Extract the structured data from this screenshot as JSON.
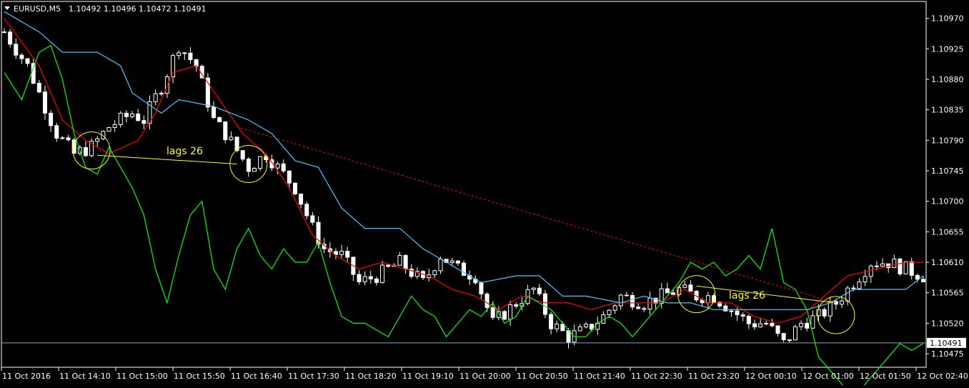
{
  "header": {
    "symbol": "EURUSD,M5",
    "quote": "1.10492 1.10496 1.10472 1.10491"
  },
  "annotations": [
    "lags 26",
    "lags 26"
  ],
  "colors": {
    "background": "#000000",
    "axis": "#ffffff",
    "candle": "#ffffff",
    "red_line": "#ff0000",
    "cyan_line": "#40c8ff",
    "green_line": "#00ff00",
    "yellow": "#ffff00",
    "price_line": "#8aa6b6"
  },
  "chart_data": {
    "type": "line",
    "title": "",
    "symbol": "EURUSD",
    "timeframe": "M5",
    "y_ticks": [
      "1.10970",
      "1.10925",
      "1.10880",
      "1.10835",
      "1.10790",
      "1.10745",
      "1.10700",
      "1.10655",
      "1.10610",
      "1.10565",
      "1.10520",
      "1.10475"
    ],
    "y_range": [
      1.10455,
      1.10995
    ],
    "x_tick_labels": [
      "11 Oct 2016",
      "11 Oct 14:10",
      "11 Oct 15:00",
      "11 Oct 15:50",
      "11 Oct 16:40",
      "11 Oct 17:30",
      "11 Oct 18:20",
      "11 Oct 19:10",
      "11 Oct 20:00",
      "11 Oct 20:50",
      "11 Oct 21:40",
      "11 Oct 22:30",
      "11 Oct 23:20",
      "12 Oct 00:10",
      "12 Oct 01:00",
      "12 Oct 01:50",
      "12 Oct 02:40"
    ],
    "current_price": "1.10491",
    "grid": false,
    "series": [
      {
        "style": "candles",
        "color": "#ffffff",
        "close_anchors": [
          [
            0,
            1.1095
          ],
          [
            4,
            1.109
          ],
          [
            7,
            1.1084
          ],
          [
            9,
            1.108
          ],
          [
            12,
            1.1077
          ],
          [
            15,
            1.1078
          ],
          [
            18,
            1.1081
          ],
          [
            22,
            1.1083
          ],
          [
            24,
            1.1082
          ],
          [
            27,
            1.1087
          ],
          [
            30,
            1.1093
          ],
          [
            33,
            1.109
          ],
          [
            36,
            1.1082
          ],
          [
            38,
            1.108
          ],
          [
            42,
            1.1075
          ],
          [
            45,
            1.1077
          ],
          [
            48,
            1.1074
          ],
          [
            50,
            1.1072
          ],
          [
            53,
            1.1066
          ],
          [
            55,
            1.1063
          ],
          [
            58,
            1.1062
          ],
          [
            61,
            1.1058
          ],
          [
            64,
            1.1059
          ],
          [
            68,
            1.1061
          ],
          [
            72,
            1.1058
          ],
          [
            75,
            1.1062
          ],
          [
            78,
            1.106
          ],
          [
            81,
            1.1059
          ],
          [
            84,
            1.1052
          ],
          [
            88,
            1.1055
          ],
          [
            91,
            1.1057
          ],
          [
            94,
            1.1052
          ],
          [
            97,
            1.105
          ],
          [
            100,
            1.1051
          ],
          [
            103,
            1.1053
          ],
          [
            106,
            1.1056
          ],
          [
            110,
            1.1055
          ],
          [
            113,
            1.1056
          ],
          [
            116,
            1.1057
          ],
          [
            119,
            1.1056
          ],
          [
            122,
            1.1056
          ],
          [
            125,
            1.1054
          ],
          [
            128,
            1.1052
          ],
          [
            131,
            1.1052
          ],
          [
            134,
            1.1049
          ],
          [
            137,
            1.1052
          ],
          [
            140,
            1.1053
          ],
          [
            143,
            1.1055
          ],
          [
            146,
            1.1058
          ],
          [
            149,
            1.1061
          ],
          [
            152,
            1.1061
          ],
          [
            155,
            1.106
          ],
          [
            158,
            1.1059
          ]
        ]
      },
      {
        "style": "line",
        "color": "#ff0000",
        "points": [
          [
            0,
            1.1097
          ],
          [
            6,
            1.109
          ],
          [
            10,
            1.1082
          ],
          [
            14,
            1.1079
          ],
          [
            18,
            1.1077
          ],
          [
            23,
            1.1079
          ],
          [
            26,
            1.1083
          ],
          [
            29,
            1.1089
          ],
          [
            33,
            1.109
          ],
          [
            37,
            1.1085
          ],
          [
            41,
            1.108
          ],
          [
            45,
            1.1077
          ],
          [
            49,
            1.1072
          ],
          [
            53,
            1.1065
          ],
          [
            57,
            1.1062
          ],
          [
            61,
            1.106
          ],
          [
            65,
            1.1061
          ],
          [
            69,
            1.106
          ],
          [
            73,
            1.1059
          ],
          [
            77,
            1.1057
          ],
          [
            81,
            1.1056
          ],
          [
            85,
            1.1054
          ],
          [
            89,
            1.1056
          ],
          [
            93,
            1.1055
          ],
          [
            97,
            1.1055
          ],
          [
            101,
            1.1054
          ],
          [
            105,
            1.1055
          ],
          [
            109,
            1.1055
          ],
          [
            113,
            1.1055
          ],
          [
            117,
            1.1057
          ],
          [
            121,
            1.1055
          ],
          [
            125,
            1.1055
          ],
          [
            129,
            1.1053
          ],
          [
            133,
            1.1052
          ],
          [
            137,
            1.1053
          ],
          [
            141,
            1.1056
          ],
          [
            145,
            1.1059
          ],
          [
            150,
            1.106
          ],
          [
            155,
            1.1061
          ],
          [
            158,
            1.1061
          ]
        ]
      },
      {
        "style": "line",
        "color": "#40c8ff",
        "points": [
          [
            0,
            1.1098
          ],
          [
            6,
            1.1095
          ],
          [
            10,
            1.1092
          ],
          [
            16,
            1.1092
          ],
          [
            20,
            1.109
          ],
          [
            22,
            1.1086
          ],
          [
            27,
            1.1083
          ],
          [
            30,
            1.1085
          ],
          [
            36,
            1.1084
          ],
          [
            42,
            1.1082
          ],
          [
            46,
            1.108
          ],
          [
            50,
            1.1076
          ],
          [
            54,
            1.1075
          ],
          [
            58,
            1.1069
          ],
          [
            62,
            1.1066
          ],
          [
            68,
            1.1066
          ],
          [
            72,
            1.1063
          ],
          [
            76,
            1.1061
          ],
          [
            82,
            1.1058
          ],
          [
            88,
            1.1059
          ],
          [
            92,
            1.1059
          ],
          [
            96,
            1.1056
          ],
          [
            100,
            1.1056
          ],
          [
            106,
            1.1055
          ],
          [
            110,
            1.1056
          ],
          [
            114,
            1.1055
          ],
          [
            118,
            1.1055
          ],
          [
            122,
            1.1054
          ],
          [
            126,
            1.1054
          ],
          [
            130,
            1.1054
          ],
          [
            134,
            1.1054
          ],
          [
            138,
            1.1054
          ],
          [
            142,
            1.1055
          ],
          [
            146,
            1.1057
          ],
          [
            150,
            1.1057
          ],
          [
            155,
            1.1057
          ],
          [
            158,
            1.1059
          ]
        ]
      },
      {
        "style": "line",
        "color": "#00ff00",
        "points": [
          [
            0,
            1.1089
          ],
          [
            3,
            1.1085
          ],
          [
            6,
            1.1092
          ],
          [
            8,
            1.1093
          ],
          [
            10,
            1.1088
          ],
          [
            12,
            1.108
          ],
          [
            14,
            1.1075
          ],
          [
            16,
            1.1074
          ],
          [
            18,
            1.1078
          ],
          [
            20,
            1.1075
          ],
          [
            22,
            1.1072
          ],
          [
            24,
            1.1068
          ],
          [
            26,
            1.106
          ],
          [
            28,
            1.1055
          ],
          [
            30,
            1.1062
          ],
          [
            32,
            1.1068
          ],
          [
            34,
            1.107
          ],
          [
            36,
            1.106
          ],
          [
            38,
            1.1057
          ],
          [
            40,
            1.1063
          ],
          [
            42,
            1.1066
          ],
          [
            44,
            1.1062
          ],
          [
            46,
            1.106
          ],
          [
            48,
            1.1063
          ],
          [
            50,
            1.1061
          ],
          [
            52,
            1.1061
          ],
          [
            54,
            1.1064
          ],
          [
            56,
            1.1058
          ],
          [
            58,
            1.1053
          ],
          [
            60,
            1.1052
          ],
          [
            62,
            1.1052
          ],
          [
            64,
            1.1051
          ],
          [
            66,
            1.105
          ],
          [
            68,
            1.1053
          ],
          [
            70,
            1.1056
          ],
          [
            72,
            1.1054
          ],
          [
            74,
            1.1053
          ],
          [
            76,
            1.105
          ],
          [
            78,
            1.1052
          ],
          [
            80,
            1.1054
          ],
          [
            82,
            1.1053
          ],
          [
            84,
            1.1055
          ],
          [
            86,
            1.1052
          ],
          [
            88,
            1.1053
          ],
          [
            90,
            1.1056
          ],
          [
            92,
            1.1055
          ],
          [
            94,
            1.1054
          ],
          [
            96,
            1.1052
          ],
          [
            98,
            1.105
          ],
          [
            100,
            1.105
          ],
          [
            102,
            1.1052
          ],
          [
            104,
            1.1053
          ],
          [
            106,
            1.1052
          ],
          [
            108,
            1.105
          ],
          [
            110,
            1.1052
          ],
          [
            112,
            1.1054
          ],
          [
            114,
            1.1056
          ],
          [
            116,
            1.1058
          ],
          [
            118,
            1.1061
          ],
          [
            120,
            1.106
          ],
          [
            122,
            1.1061
          ],
          [
            124,
            1.1059
          ],
          [
            126,
            1.106
          ],
          [
            128,
            1.1062
          ],
          [
            130,
            1.106
          ],
          [
            132,
            1.1066
          ],
          [
            134,
            1.1058
          ],
          [
            136,
            1.1057
          ],
          [
            138,
            1.1054
          ],
          [
            140,
            1.1047
          ],
          [
            142,
            1.1045
          ],
          [
            144,
            1.1043
          ],
          [
            146,
            1.1041
          ],
          [
            148,
            1.1043
          ],
          [
            150,
            1.1045
          ],
          [
            152,
            1.1047
          ],
          [
            154,
            1.1049
          ],
          [
            156,
            1.1048
          ],
          [
            158,
            1.1049
          ]
        ]
      }
    ]
  }
}
